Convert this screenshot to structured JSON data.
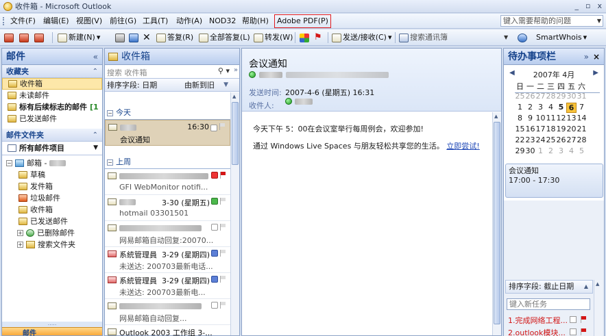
{
  "window": {
    "title": "收件箱 - Microsoft Outlook",
    "controls": [
      "_",
      "▫",
      "x"
    ]
  },
  "menubar": {
    "items": [
      "文件(F)",
      "编辑(E)",
      "视图(V)",
      "前往(G)",
      "工具(T)",
      "动作(A)",
      "NOD32",
      "帮助(H)",
      "Adobe PDF(P)"
    ],
    "help_placeholder": "键入需要帮助的问题"
  },
  "toolbar": {
    "new_label": "新建(N)",
    "reply_label": "答复(R)",
    "reply_all_label": "全部答复(L)",
    "forward_label": "转发(W)",
    "send_receive_label": "发送/接收(C)",
    "contact_search_placeholder": "搜索通讯簿",
    "smartwhois_label": "SmartWhois"
  },
  "nav": {
    "title": "邮件",
    "favorites_header": "收藏夹",
    "favorites": [
      {
        "label": "收件箱"
      },
      {
        "label": "未读邮件"
      },
      {
        "label": "标有后续标志的邮件",
        "count": "[1"
      },
      {
        "label": "已发送邮件"
      }
    ],
    "folders_header": "邮件文件夹",
    "all_items_label": "所有邮件项目",
    "mailbox_label": "邮箱 -",
    "folders": [
      "草稿",
      "发件箱",
      "垃圾邮件",
      "收件箱",
      "已发送邮件"
    ],
    "deleted_label": "已删除邮件",
    "search_folders_label": "搜索文件夹",
    "mail_button_label": "邮件",
    "grip": "....."
  },
  "list": {
    "title": "收件箱",
    "search_placeholder": "搜索 收件箱",
    "sort_label": "排序字段: 日期",
    "order_label": "由新到旧",
    "groups": [
      "今天",
      "上周"
    ],
    "today_messages": [
      {
        "time": "16:30",
        "subject": "会议通知"
      }
    ],
    "last_week_messages": [
      {
        "date": "",
        "subject": "GFI WebMonitor notifi...",
        "flag": "red"
      },
      {
        "date": "3-30 (星期五)",
        "subject": "hotmail 03301501"
      },
      {
        "date": "",
        "subject": "网易邮箱自动回复:20070..."
      },
      {
        "from": "系統管理員",
        "date": "3-29 (星期四)",
        "subject": "未送达: 200703最新电话..."
      },
      {
        "from": "系統管理員",
        "date": "3-29 (星期四)",
        "subject": "未送达: 200703最新电..."
      },
      {
        "date": "",
        "subject": "网易邮箱自动回复..."
      },
      {
        "subject": "Outlook 2003 工作组 3-..."
      }
    ]
  },
  "reader": {
    "subject": "会议通知",
    "sent_label": "发送时间:",
    "sent_value": "2007-4-6 (星期五) 16:31",
    "to_label": "收件人:",
    "body_line1": "今天下午 5：00在会议室举行每周例会，欢迎参加!",
    "body_line2_text": "通过 Windows Live Spaces 与朋友轻松共享您的生活。",
    "body_line2_link": "立即尝试!"
  },
  "todo": {
    "title": "待办事项栏",
    "calendar": {
      "month": "2007年 4月",
      "dow": [
        "日",
        "一",
        "二",
        "三",
        "四",
        "五",
        "六"
      ],
      "weeks": [
        [
          "25",
          "26",
          "27",
          "28",
          "29",
          "30",
          "31"
        ],
        [
          "1",
          "2",
          "3",
          "4",
          "5",
          "6",
          "7"
        ],
        [
          "8",
          "9",
          "10",
          "11",
          "12",
          "13",
          "14"
        ],
        [
          "15",
          "16",
          "17",
          "18",
          "19",
          "20",
          "21"
        ],
        [
          "22",
          "23",
          "24",
          "25",
          "26",
          "27",
          "28"
        ],
        [
          "29",
          "30",
          "1",
          "2",
          "3",
          "4",
          "5"
        ]
      ],
      "today": "6"
    },
    "appointment_title": "会议通知",
    "appointment_time": "17:00 - 17:30",
    "task_sort_label": "排序字段: 截止日期",
    "new_task_placeholder": "键入新任务",
    "tasks": [
      "1.完成网络工程...",
      "2.outlook模块..."
    ]
  },
  "colors": {
    "accent": "#15428b",
    "selection": "#fde7a9",
    "highlight_border": "#e0181b",
    "today": "#f8c33a"
  }
}
